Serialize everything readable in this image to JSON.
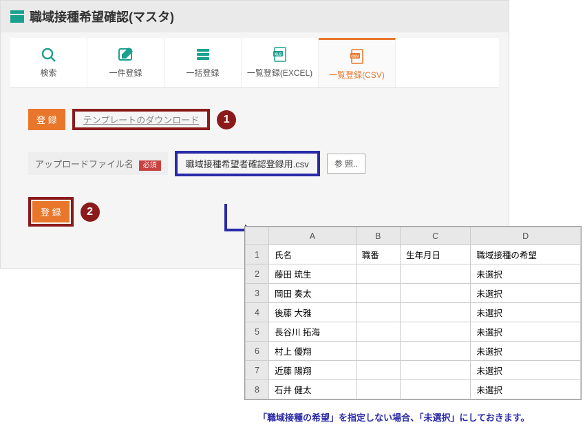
{
  "title": "職域接種希望確認(マスタ)",
  "tabs": [
    {
      "label": "検索"
    },
    {
      "label": "一件登録"
    },
    {
      "label": "一括登録"
    },
    {
      "label": "一覧登録(EXCEL)"
    },
    {
      "label": "一覧登録(CSV)"
    }
  ],
  "buttons": {
    "register": "登 録",
    "register2": "登 録",
    "template_download": "テンプレートのダウンロード",
    "browse": "参 照.."
  },
  "upload": {
    "label": "アップロードファイル名",
    "required": "必須",
    "filename": "職域接種希望者確認登録用.csv"
  },
  "badges": {
    "one": "1",
    "two": "2"
  },
  "spreadsheet": {
    "cols": [
      "A",
      "B",
      "C",
      "D"
    ],
    "headers": [
      "氏名",
      "職番",
      "生年月日",
      "職域接種の希望"
    ],
    "rows": [
      {
        "n": "1",
        "a": "氏名",
        "b": "職番",
        "c": "生年月日",
        "d": "職域接種の希望"
      },
      {
        "n": "2",
        "a": "藤田 琉生",
        "b": "",
        "c": "",
        "d": "未選択"
      },
      {
        "n": "3",
        "a": "岡田 奏太",
        "b": "",
        "c": "",
        "d": "未選択"
      },
      {
        "n": "4",
        "a": "後藤 大雅",
        "b": "",
        "c": "",
        "d": "未選択"
      },
      {
        "n": "5",
        "a": "長谷川 拓海",
        "b": "",
        "c": "",
        "d": "未選択"
      },
      {
        "n": "6",
        "a": "村上 優翔",
        "b": "",
        "c": "",
        "d": "未選択"
      },
      {
        "n": "7",
        "a": "近藤 陽翔",
        "b": "",
        "c": "",
        "d": "未選択"
      },
      {
        "n": "8",
        "a": "石井 健太",
        "b": "",
        "c": "",
        "d": "未選択"
      }
    ]
  },
  "caption": "「職域接種の希望」を指定しない場合、「未選択」にしておきます。"
}
